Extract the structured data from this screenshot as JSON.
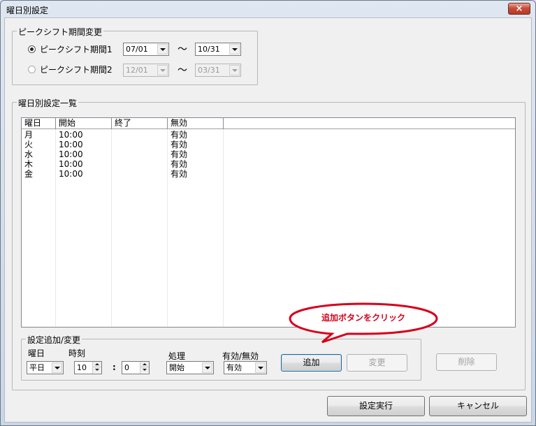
{
  "window": {
    "title": "曜日別設定",
    "close_glyph": "×"
  },
  "peak": {
    "legend": "ピークシフト期間変更",
    "period1": {
      "label": "ピークシフト期間1",
      "checked": true,
      "from": "07/01",
      "to": "10/31"
    },
    "period2": {
      "label": "ピークシフト期間2",
      "checked": false,
      "from": "12/01",
      "to": "03/31"
    },
    "tilde": "～"
  },
  "list": {
    "legend": "曜日別設定一覧",
    "columns": [
      "曜日",
      "開始",
      "終了",
      "無効"
    ],
    "rows": [
      {
        "day": "月",
        "start": "10:00",
        "end": "",
        "status": "有効"
      },
      {
        "day": "火",
        "start": "10:00",
        "end": "",
        "status": "有効"
      },
      {
        "day": "水",
        "start": "10:00",
        "end": "",
        "status": "有効"
      },
      {
        "day": "木",
        "start": "10:00",
        "end": "",
        "status": "有効"
      },
      {
        "day": "金",
        "start": "10:00",
        "end": "",
        "status": "有効"
      }
    ]
  },
  "edit": {
    "legend": "設定追加/変更",
    "day_label": "曜日",
    "day_value": "平日",
    "time_label": "時刻",
    "hour": "10",
    "colon": ":",
    "minute": "0",
    "action_label": "処理",
    "action_value": "開始",
    "valid_label": "有効/無効",
    "valid_value": "有効",
    "add": "追加",
    "change": "変更"
  },
  "delete": "削除",
  "callout": {
    "text": "追加ボタンをクリック",
    "color": "#d6001c"
  },
  "footer": {
    "execute": "設定実行",
    "cancel": "キャンセル"
  }
}
